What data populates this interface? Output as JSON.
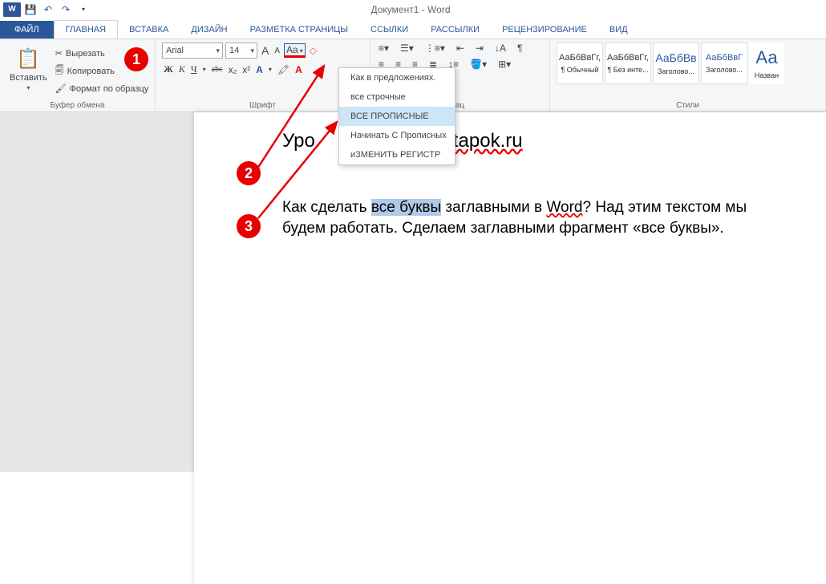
{
  "window_title": "Документ1 - Word",
  "qat": {
    "app": "W"
  },
  "tabs": [
    "ФАЙЛ",
    "ГЛАВНАЯ",
    "ВСТАВКА",
    "ДИЗАЙН",
    "РАЗМЕТКА СТРАНИЦЫ",
    "ССЫЛКИ",
    "РАССЫЛКИ",
    "РЕЦЕНЗИРОВАНИЕ",
    "ВИД"
  ],
  "clipboard": {
    "paste": "Вставить",
    "cut": "Вырезать",
    "copy": "Копировать",
    "format": "Формат по образцу",
    "group": "Буфер обмена"
  },
  "font": {
    "name": "Arial",
    "size": "14",
    "group": "Шрифт",
    "bold": "Ж",
    "italic": "К",
    "underline": "Ч",
    "strike": "abc",
    "sub": "x₂",
    "sup": "x²",
    "case_btn": "Aa",
    "grow": "A",
    "shrink": "A"
  },
  "case_menu": {
    "sentence": "Как в предложениях.",
    "lower": "все строчные",
    "upper": "ВСЕ ПРОПИСНЫЕ",
    "capwords": "Начинать С Прописных",
    "toggle": "иЗМЕНИТЬ РЕГИСТР"
  },
  "para": {
    "group": "ац"
  },
  "styles": {
    "group": "Стили",
    "s1": {
      "preview": "АаБбВвГг,",
      "label": "¶ Обычный"
    },
    "s2": {
      "preview": "АаБбВвГг,",
      "label": "¶ Без инте..."
    },
    "s3": {
      "preview": "АаБбВв",
      "label": "Заголово..."
    },
    "s4": {
      "preview": "АаБбВвГ",
      "label": "Заголово..."
    },
    "s5": {
      "preview": "Аа",
      "label": "Назван"
    }
  },
  "doc": {
    "title_vis": "Уро",
    "title_rest": "tapok.ru",
    "line1a": "Как сделать ",
    "sel": "все буквы",
    "line1b": " заглавными в ",
    "wordlink": "Word",
    "line1c": "? Над этим текстом мы будем работать. Сделаем заглавными фрагмент «все буквы»."
  },
  "annot": {
    "a1": "1",
    "a2": "2",
    "a3": "3"
  }
}
